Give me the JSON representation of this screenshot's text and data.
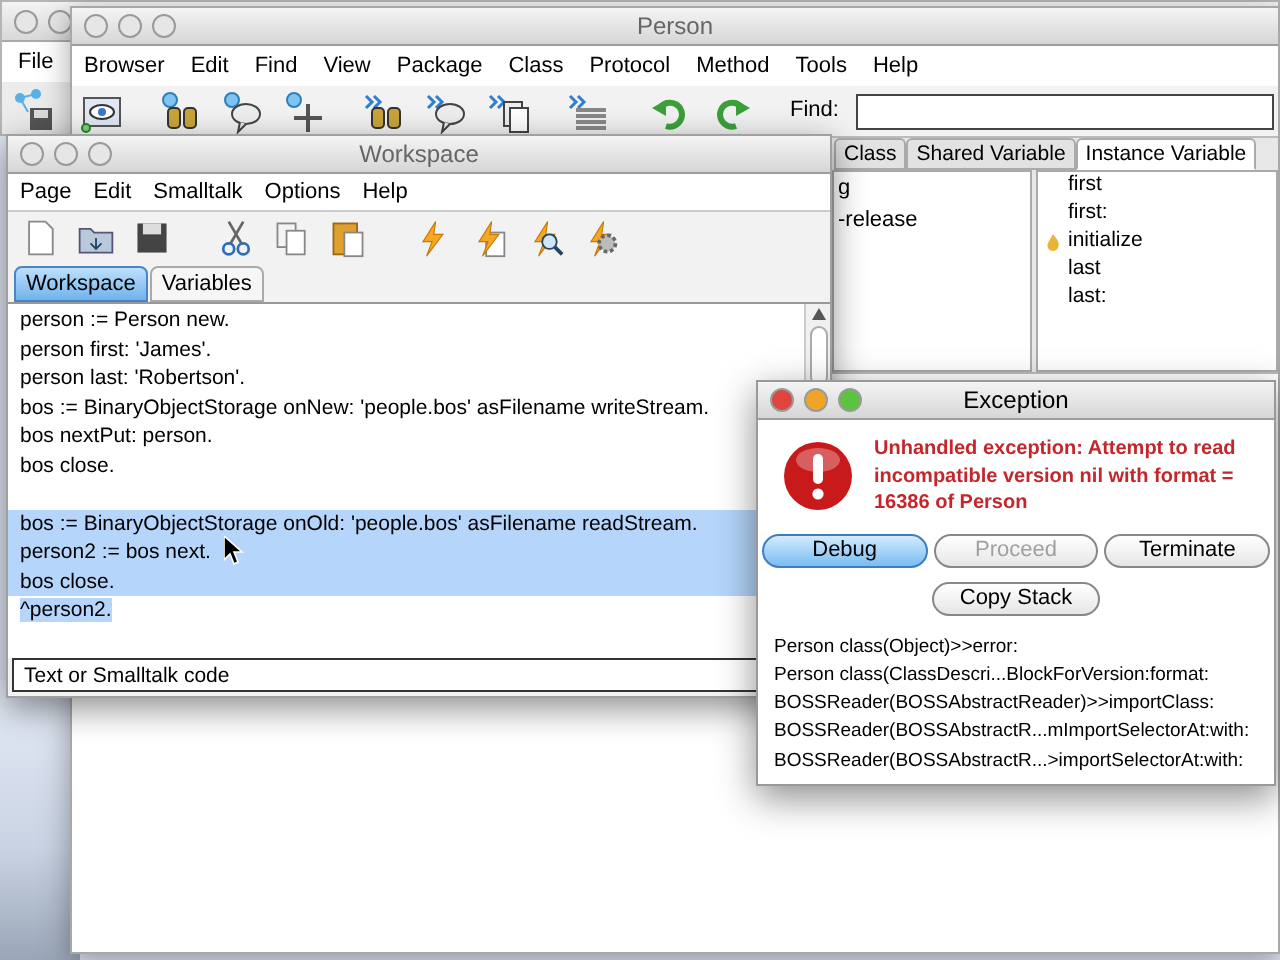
{
  "launcher_window": {
    "menu": [
      "File"
    ]
  },
  "browser_window": {
    "title": "Person",
    "menu": [
      "Browser",
      "Edit",
      "Find",
      "View",
      "Package",
      "Class",
      "Protocol",
      "Method",
      "Tools",
      "Help"
    ],
    "find_label": "Find:",
    "tabs": [
      {
        "label": "Class",
        "selected": false
      },
      {
        "label": "Shared Variable",
        "selected": false
      },
      {
        "label": "Instance Variable",
        "selected": true
      }
    ],
    "category_items": [
      "g",
      "-release"
    ],
    "method_items": [
      {
        "label": "first",
        "kind": "plain"
      },
      {
        "label": "first:",
        "kind": "plain"
      },
      {
        "label": "initialize",
        "kind": "override"
      },
      {
        "label": "last",
        "kind": "plain"
      },
      {
        "label": "last:",
        "kind": "plain"
      }
    ]
  },
  "workspace_window": {
    "title": "Workspace",
    "menu": [
      "Page",
      "Edit",
      "Smalltalk",
      "Options",
      "Help"
    ],
    "tabs": [
      {
        "label": "Workspace",
        "selected": true
      },
      {
        "label": "Variables",
        "selected": false
      }
    ],
    "lines": [
      {
        "kind": "code",
        "text": "person := Person new.",
        "selected": false
      },
      {
        "kind": "code",
        "text": "person first: 'James'.",
        "selected": false
      },
      {
        "kind": "code",
        "text": "person last: 'Robertson'.",
        "selected": false
      },
      {
        "kind": "code",
        "text": "bos := BinaryObjectStorage onNew: 'people.bos' asFilename writeStream.",
        "selected": false
      },
      {
        "kind": "code",
        "text": "bos nextPut: person.",
        "selected": false
      },
      {
        "kind": "code",
        "text": "bos close.",
        "selected": false
      },
      {
        "kind": "blank",
        "selected": false
      },
      {
        "kind": "code",
        "text": "bos := BinaryObjectStorage onOld: 'people.bos' asFilename readStream.",
        "selected": true
      },
      {
        "kind": "code",
        "text": "person2 := bos next.",
        "selected": true
      },
      {
        "kind": "code",
        "text": "bos close.",
        "selected": true
      },
      {
        "kind": "code",
        "text": "^person2.",
        "selected": true
      }
    ],
    "status": "Text or Smalltalk code"
  },
  "exception_dialog": {
    "title": "Exception",
    "message": "Unhandled exception: Attempt to read incompatible version nil with format = 16386 of Person",
    "buttons": [
      {
        "label": "Debug",
        "default": true,
        "disabled": false
      },
      {
        "label": "Proceed",
        "default": false,
        "disabled": true
      },
      {
        "label": "Terminate",
        "default": false,
        "disabled": false
      }
    ],
    "copy_button": "Copy Stack",
    "stack": [
      "Person class(Object)>>error:",
      "Person class(ClassDescri...BlockForVersion:format:",
      "BOSSReader(BOSSAbstractReader)>>importClass:",
      "BOSSReader(BOSSAbstractR...mImportSelectorAt:with:",
      "BOSSReader(BOSSAbstractR...>importSelectorAt:with:"
    ]
  }
}
